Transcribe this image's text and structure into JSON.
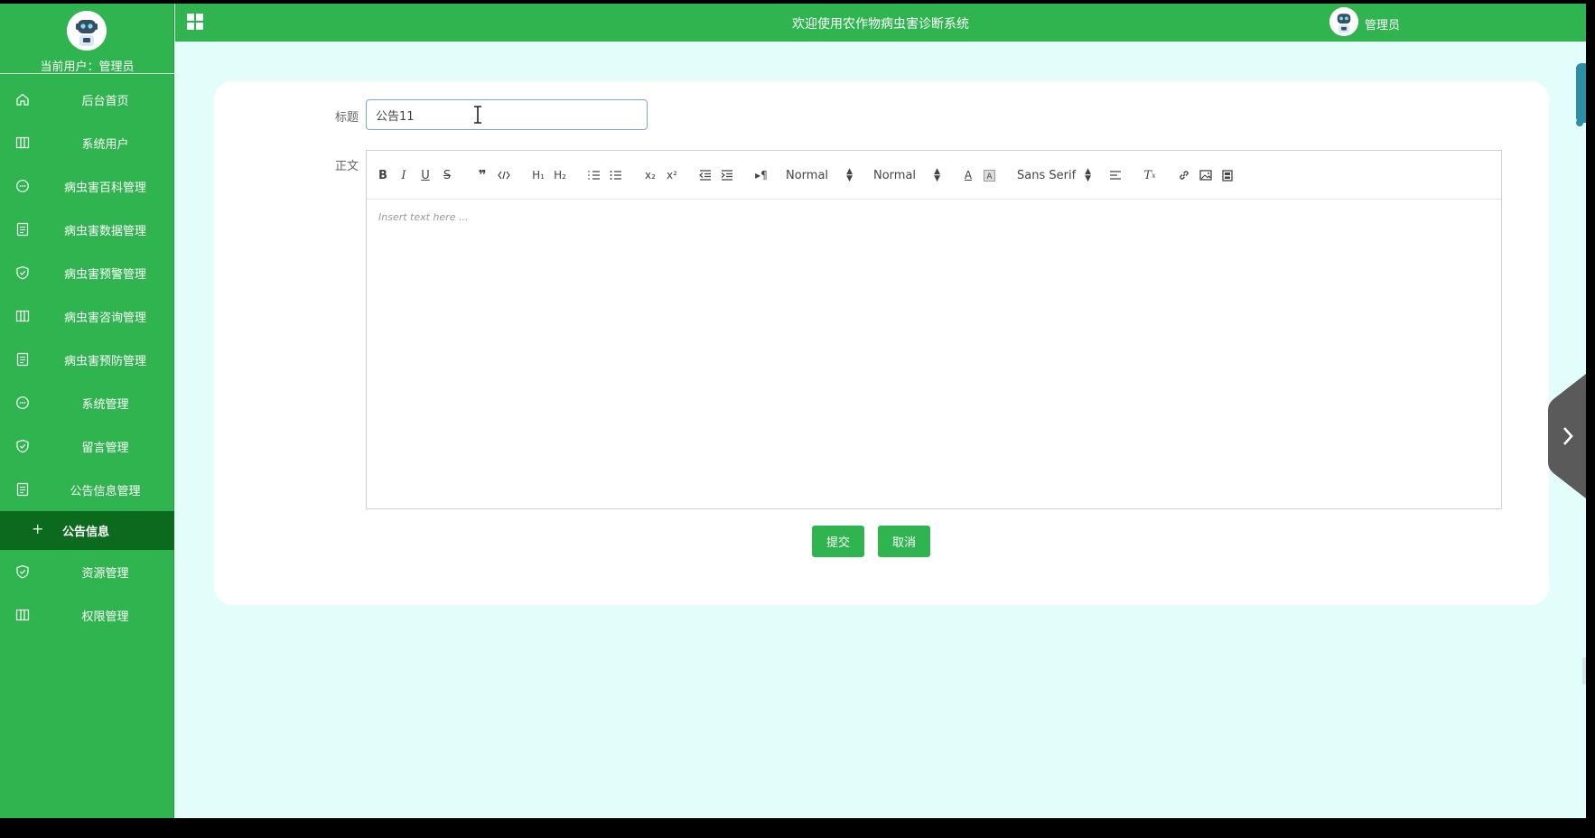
{
  "app": {
    "site_title": "欢迎使用农作物病虫害诊断系统",
    "current_user_label": "当前用户：管理员",
    "top_user": "管理员"
  },
  "sidebar": {
    "items": [
      {
        "label": "后台首页",
        "icon": "home-icon"
      },
      {
        "label": "系统用户",
        "icon": "columns-icon"
      },
      {
        "label": "病虫害百科管理",
        "icon": "chat-icon"
      },
      {
        "label": "病虫害数据管理",
        "icon": "document-icon"
      },
      {
        "label": "病虫害预警管理",
        "icon": "shield-icon"
      },
      {
        "label": "病虫害咨询管理",
        "icon": "columns-icon"
      },
      {
        "label": "病虫害预防管理",
        "icon": "document-icon"
      },
      {
        "label": "系统管理",
        "icon": "chat-icon"
      },
      {
        "label": "留言管理",
        "icon": "shield-icon"
      },
      {
        "label": "公告信息管理",
        "icon": "document-icon"
      }
    ],
    "sub_item": {
      "label": "公告信息",
      "icon": "plus-icon"
    },
    "items_after": [
      {
        "label": "资源管理",
        "icon": "shield-icon"
      },
      {
        "label": "权限管理",
        "icon": "columns-icon"
      }
    ]
  },
  "form": {
    "title_label": "标题",
    "title_value": "公告11",
    "body_label": "正文",
    "editor_placeholder": "Insert text here ...",
    "header_select": "Normal",
    "size_select": "Normal",
    "font_select": "Sans Serif",
    "submit_label": "提交",
    "cancel_label": "取消"
  },
  "colors": {
    "brand_green": "#2fb44f",
    "active_menu": "#0b6a1e",
    "content_bg": "#e3fdfb"
  }
}
